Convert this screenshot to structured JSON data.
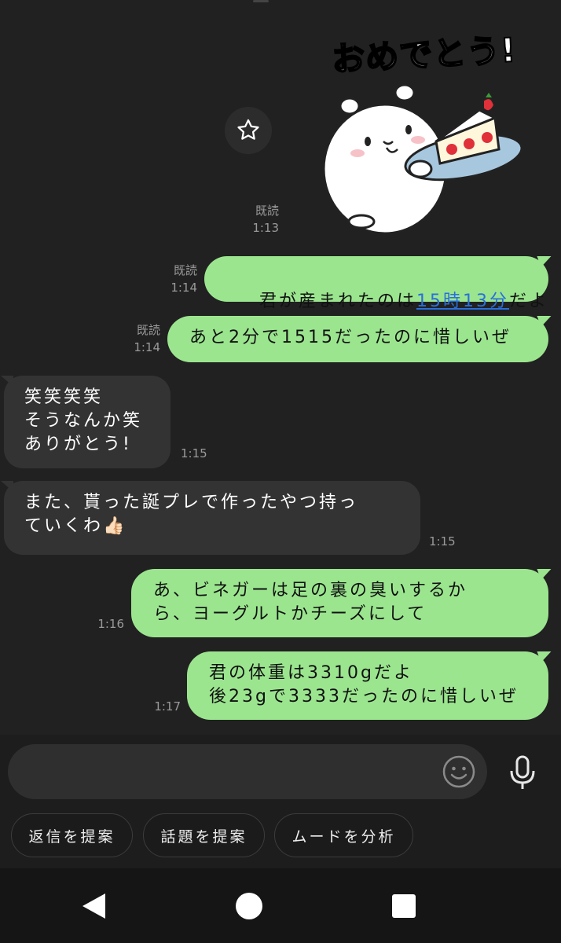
{
  "sticker": {
    "text": "おめでとう!"
  },
  "messages": [
    {
      "dir": "out",
      "read": "既読",
      "time": "1:13"
    },
    {
      "dir": "out",
      "read": "既読",
      "time": "1:14",
      "text_pre": "君が産まれたのは",
      "link": "15時13分",
      "text_post": "だよ"
    },
    {
      "dir": "out",
      "read": "既読",
      "time": "1:14",
      "text": "あと2分で1515だったのに惜しいぜ"
    },
    {
      "dir": "in",
      "time": "1:15",
      "text": "笑笑笑笑\nそうなんか笑\nありがとう!"
    },
    {
      "dir": "in",
      "time": "1:15",
      "text": "また、貰った誕プレで作ったやつ持っ\nていくわ👍🏻"
    },
    {
      "dir": "out",
      "time": "1:16",
      "text": "あ、ビネガーは足の裏の臭いするか\nら、ヨーグルトかチーズにして"
    },
    {
      "dir": "out",
      "time": "1:17",
      "text": "君の体重は3310gだよ\n後23gで3333だったのに惜しいぜ"
    }
  ],
  "input": {
    "placeholder": ""
  },
  "suggestions": [
    "返信を提案",
    "話題を提案",
    "ムードを分析"
  ],
  "colors": {
    "outgoing_bubble": "#9be58f",
    "incoming_bubble": "#333333",
    "background": "#212121",
    "link": "#2a6fdb"
  },
  "icons": {
    "sticker_action": "star-icon",
    "emoji": "smiley-icon",
    "mic": "microphone-icon",
    "nav": [
      "back-triangle-icon",
      "home-circle-icon",
      "recents-square-icon"
    ]
  }
}
